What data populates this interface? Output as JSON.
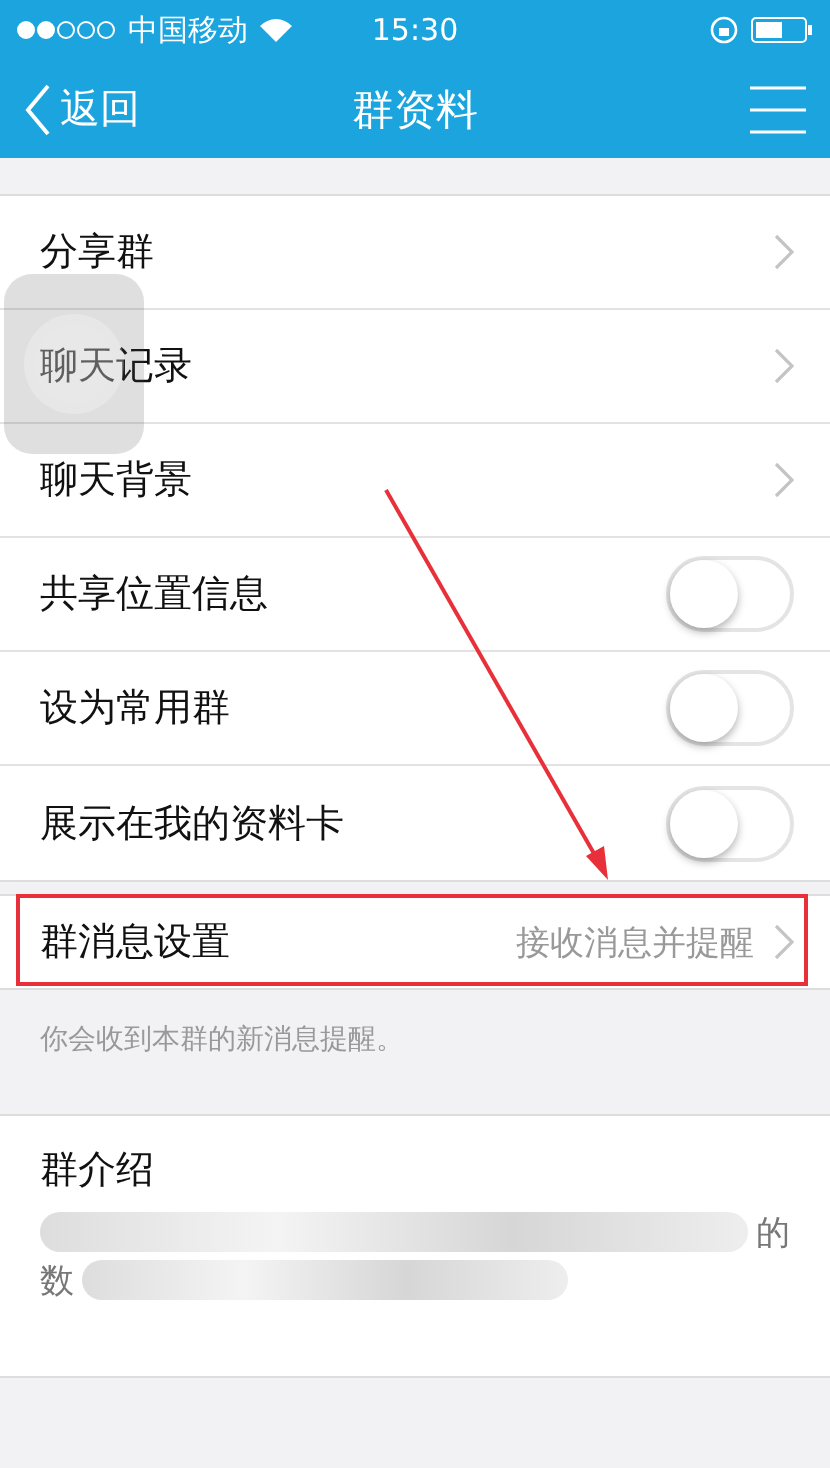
{
  "status_bar": {
    "carrier": "中国移动",
    "time": "15:30"
  },
  "nav": {
    "back": "返回",
    "title": "群资料"
  },
  "items": [
    {
      "kind": "link",
      "label": "分享群"
    },
    {
      "kind": "link",
      "label": "聊天记录"
    },
    {
      "kind": "link",
      "label": "聊天背景"
    },
    {
      "kind": "toggle",
      "label": "共享位置信息",
      "on": false
    },
    {
      "kind": "toggle",
      "label": "设为常用群",
      "on": false
    },
    {
      "kind": "toggle",
      "label": "展示在我的资料卡",
      "on": false
    }
  ],
  "message_setting": {
    "label": "群消息设置",
    "value": "接收消息并提醒",
    "highlighted": true
  },
  "message_note": "你会收到本群的新消息提醒。",
  "intro": {
    "title": "群介绍",
    "line_1_end": "的",
    "line_2_start": "数"
  }
}
